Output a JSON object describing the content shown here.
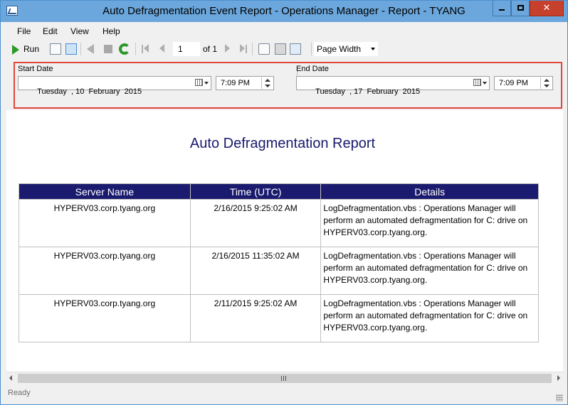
{
  "window": {
    "title": "Auto Defragmentation Event Report - Operations Manager - Report - TYANG",
    "close_glyph": "✕"
  },
  "menu": [
    "File",
    "Edit",
    "View",
    "Help"
  ],
  "toolbar": {
    "run_label": "Run",
    "page_value": "1",
    "page_of": "of 1",
    "zoom": "Page Width"
  },
  "params": {
    "start_label": "Start Date",
    "start_date": "Tuesday  , 10  February  2015",
    "start_time": "7:09 PM",
    "end_label": "End Date",
    "end_date": "Tuesday  , 17  February  2015",
    "end_time": "7:09 PM"
  },
  "report": {
    "title": "Auto Defragmentation Report",
    "columns": [
      "Server Name",
      "Time (UTC)",
      "Details"
    ],
    "rows": [
      {
        "server": "HYPERV03.corp.tyang.org",
        "time": "2/16/2015 9:25:02 AM",
        "details": "LogDefragmentation.vbs : Operations Manager will perform an automated defragmentation for C: drive on HYPERV03.corp.tyang.org."
      },
      {
        "server": "HYPERV03.corp.tyang.org",
        "time": "2/16/2015 11:35:02 AM",
        "details": "LogDefragmentation.vbs : Operations Manager will perform an automated defragmentation for C: drive on HYPERV03.corp.tyang.org."
      },
      {
        "server": "HYPERV03.corp.tyang.org",
        "time": "2/11/2015 9:25:02 AM",
        "details": "LogDefragmentation.vbs : Operations Manager will perform an automated defragmentation for C: drive on HYPERV03.corp.tyang.org."
      }
    ]
  },
  "status": {
    "text": "Ready"
  }
}
